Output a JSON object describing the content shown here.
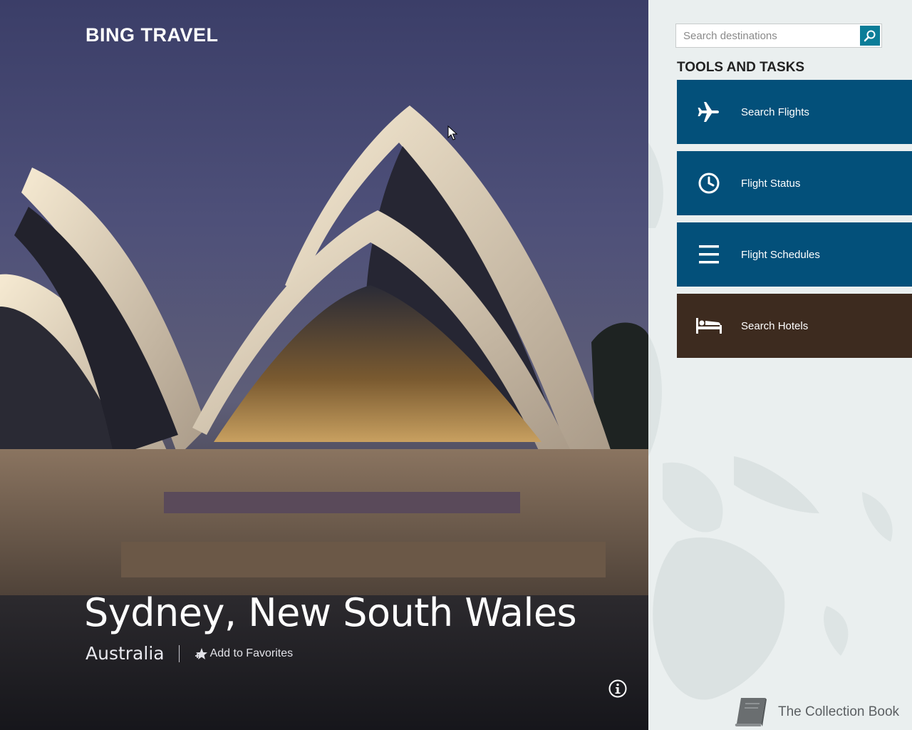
{
  "app": {
    "title": "BING TRAVEL"
  },
  "hero": {
    "city": "Sydney, New South Wales",
    "country": "Australia",
    "favorites_label": "Add to Favorites"
  },
  "icons": {
    "info": "info-icon",
    "star": "star-add-icon",
    "search": "search-icon",
    "cursor": "mouse-cursor-icon"
  },
  "search": {
    "placeholder": "Search destinations",
    "value": ""
  },
  "tools": {
    "title": "TOOLS AND TASKS",
    "items": [
      {
        "label": "Search Flights",
        "icon": "airplane-icon",
        "color": "#03507a"
      },
      {
        "label": "Flight Status",
        "icon": "clock-icon",
        "color": "#03507a"
      },
      {
        "label": "Flight Schedules",
        "icon": "list-icon",
        "color": "#03507a"
      },
      {
        "label": "Search Hotels",
        "icon": "bed-icon",
        "color": "#3d2b1f"
      }
    ]
  },
  "collection": {
    "label": "The Collection Book",
    "icon": "book-icon"
  },
  "colors": {
    "accent": "#0b7d98",
    "tile_blue": "#03507a",
    "tile_brown": "#3d2b1f"
  }
}
